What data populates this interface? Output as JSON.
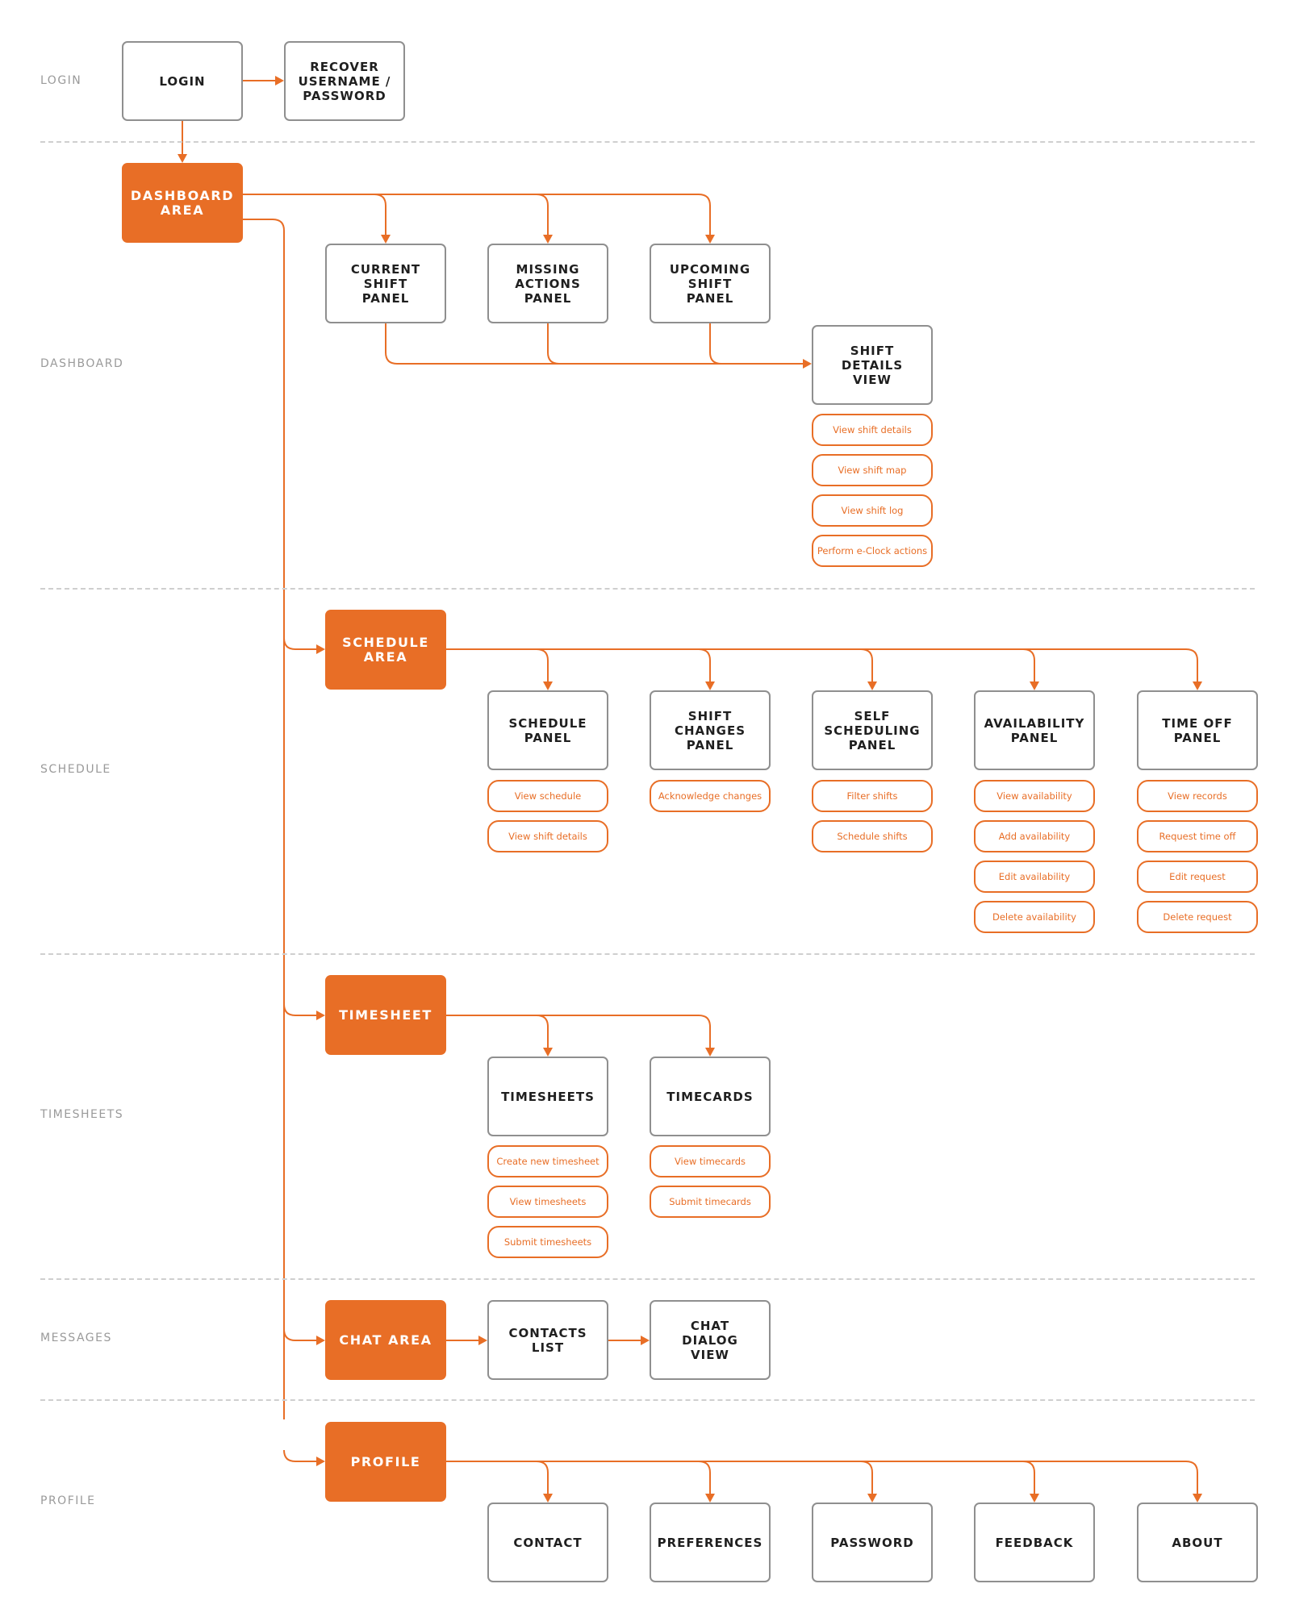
{
  "colors": {
    "accent": "#e86e26",
    "box_border": "#8f8f8f",
    "text": "#1f1f1f",
    "section_label": "#9a9a9a",
    "divider": "#cfcfcf"
  },
  "sections": {
    "login": "LOGIN",
    "dashboard": "DASHBOARD",
    "schedule": "SCHEDULE",
    "timesheets": "TIMESHEETS",
    "messages": "MESSAGES",
    "profile": "PROFILE"
  },
  "nodes": {
    "login": "LOGIN",
    "recover": "RECOVER\nUSERNAME /\nPASSWORD",
    "dashboard_area": "DASHBOARD\nAREA",
    "current_shift": "CURRENT\nSHIFT\nPANEL",
    "missing_actions": "MISSING\nACTIONS\nPANEL",
    "upcoming_shift": "UPCOMING\nSHIFT\nPANEL",
    "shift_details": "SHIFT\nDETAILS\nVIEW",
    "schedule_area": "SCHEDULE\nAREA",
    "schedule_panel": "SCHEDULE\nPANEL",
    "shift_changes": "SHIFT\nCHANGES\nPANEL",
    "self_scheduling": "SELF\nSCHEDULING\nPANEL",
    "availability": "AVAILABILITY\nPANEL",
    "time_off": "TIME OFF\nPANEL",
    "timesheet": "TIMESHEET",
    "timesheets": "TIMESHEETS",
    "timecards": "TIMECARDS",
    "chat_area": "CHAT AREA",
    "contacts_list": "CONTACTS\nLIST",
    "chat_dialog": "CHAT\nDIALOG\nVIEW",
    "profile": "PROFILE",
    "contact": "CONTACT",
    "preferences": "PREFERENCES",
    "password": "PASSWORD",
    "feedback": "FEEDBACK",
    "about": "ABOUT"
  },
  "actions": {
    "shift_details": [
      "View shift details",
      "View shift map",
      "View shift log",
      "Perform e-Clock actions"
    ],
    "schedule_panel": [
      "View schedule",
      "View shift details"
    ],
    "shift_changes": [
      "Acknowledge changes"
    ],
    "self_scheduling": [
      "Filter shifts",
      "Schedule shifts"
    ],
    "availability": [
      "View availability",
      "Add availability",
      "Edit availability",
      "Delete availability"
    ],
    "time_off": [
      "View records",
      "Request time off",
      "Edit request",
      "Delete request"
    ],
    "timesheets": [
      "Create new timesheet",
      "View timesheets",
      "Submit timesheets"
    ],
    "timecards": [
      "View timecards",
      "Submit timecards"
    ]
  }
}
